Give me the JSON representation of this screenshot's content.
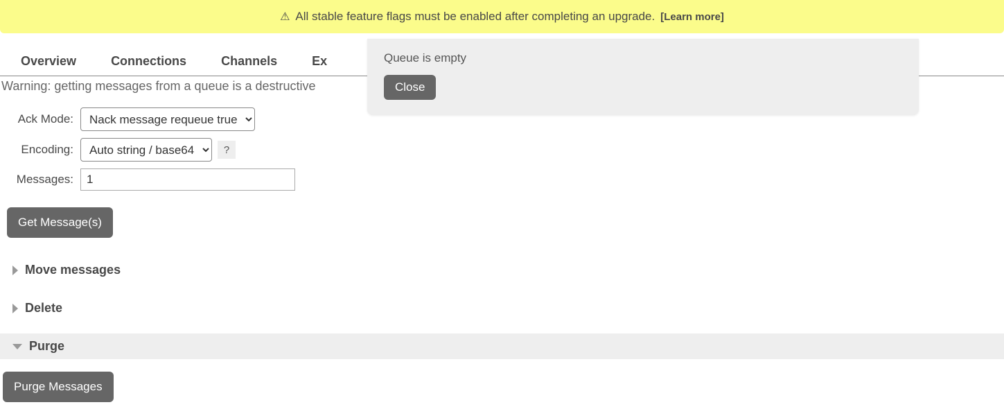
{
  "banner": {
    "icon": "⚠",
    "text": "All stable feature flags must be enabled after completing an upgrade.",
    "link": "[Learn more]"
  },
  "tabs": [
    "Overview",
    "Connections",
    "Channels",
    "Ex"
  ],
  "warning_line": "Warning: getting messages from a queue is a destructive",
  "form": {
    "ack_mode": {
      "label": "Ack Mode:",
      "value": "Nack message requeue true"
    },
    "encoding": {
      "label": "Encoding:",
      "value": "Auto string / base64",
      "help": "?"
    },
    "messages": {
      "label": "Messages:",
      "value": "1"
    },
    "get_button": "Get Message(s)"
  },
  "sections": {
    "move": {
      "title": "Move messages"
    },
    "delete": {
      "title": "Delete"
    },
    "purge": {
      "title": "Purge",
      "button": "Purge Messages"
    }
  },
  "popup": {
    "text": "Queue is empty",
    "close": "Close"
  }
}
